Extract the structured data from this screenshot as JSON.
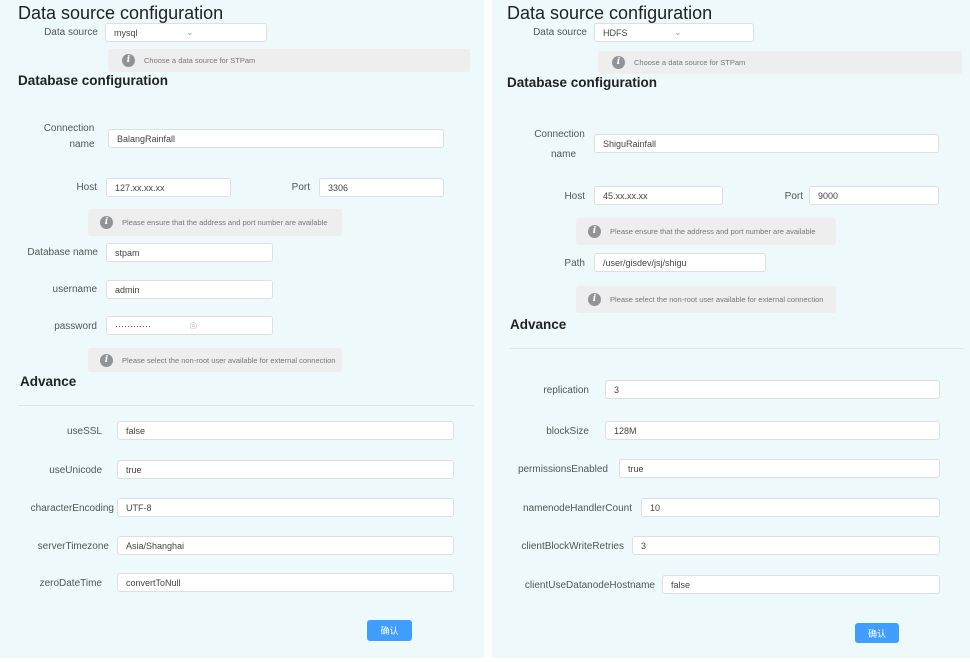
{
  "left": {
    "title": "Data source configuration",
    "data_source_label": "Data source",
    "data_source_value": "mysql",
    "data_source_hint": "Choose a data source for STPam",
    "db_section": "Database configuration",
    "connection_name_label_1": "Connection",
    "connection_name_label_2": "name",
    "connection_name_value": "BalangRainfall",
    "host_label": "Host",
    "host_value": "127.xx.xx.xx",
    "port_label": "Port",
    "port_value": "3306",
    "address_hint": "Please ensure that the address and port number are available",
    "database_name_label": "Database name",
    "database_name_value": "stpam",
    "username_label": "username",
    "username_value": "admin",
    "password_label": "password",
    "password_value": "············",
    "user_hint": "Please select the non-root user available for external connection",
    "advance_section": "Advance",
    "advance_fields": [
      {
        "label": "useSSL",
        "value": "false"
      },
      {
        "label": "useUnicode",
        "value": "true"
      },
      {
        "label": "characterEncoding",
        "value": "UTF-8"
      },
      {
        "label": "serverTimezone",
        "value": "Asia/Shanghai"
      },
      {
        "label": "zeroDateTime",
        "value": "convertToNull"
      }
    ],
    "confirm_label": "确认"
  },
  "right": {
    "title": "Data source configuration",
    "data_source_label": "Data source",
    "data_source_value": "HDFS",
    "data_source_hint": "Choose a data source for STPam",
    "db_section": "Database configuration",
    "connection_name_label_1": "Connection",
    "connection_name_label_2": "name",
    "connection_name_value": "ShiguRainfall",
    "host_label": "Host",
    "host_value": "45.xx.xx.xx",
    "port_label": "Port",
    "port_value": "9000",
    "address_hint": "Please ensure that the address and port number are available",
    "path_label": "Path",
    "path_value": "/user/gisdev/jsj/shigu",
    "user_hint": "Please select the non-root user available for external connection",
    "advance_section": "Advance",
    "advance_fields": [
      {
        "label": "replication",
        "value": "3"
      },
      {
        "label": "blockSize",
        "value": "128M"
      },
      {
        "label": "permissionsEnabled",
        "value": "true"
      },
      {
        "label": "namenodeHandlerCount",
        "value": "10"
      },
      {
        "label": "clientBlockWriteRetries",
        "value": "3"
      },
      {
        "label": "clientUseDatanodeHostname",
        "value": "false"
      }
    ],
    "confirm_label": "确认"
  },
  "icons": {
    "info": "info-icon",
    "chevron": "chevron-down-icon",
    "eye": "eye-icon"
  },
  "colors": {
    "panel_bg": "#edf9fa",
    "primary": "#409eff",
    "hint_bg": "#eeeeee"
  }
}
